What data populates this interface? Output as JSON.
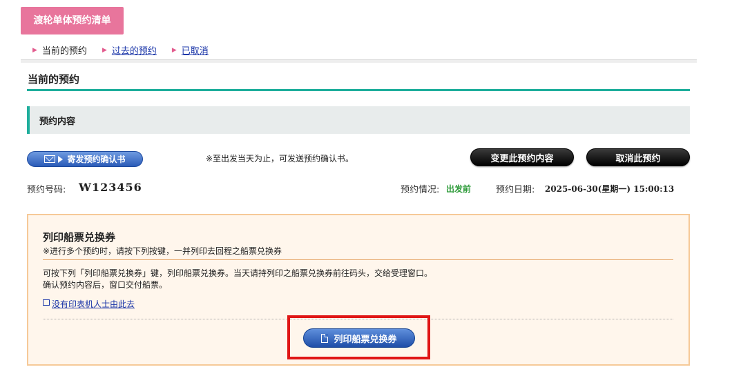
{
  "header": {
    "tab_title": "渡轮单体预约清单"
  },
  "subnav": {
    "current": "当前的预约",
    "past": "过去的预约",
    "cancelled": "已取消"
  },
  "page": {
    "title": "当前的预约"
  },
  "section": {
    "title": "预约内容"
  },
  "actions": {
    "send_confirmation": "寄发预约确认书",
    "send_note": "※至出发当天为止，可发送预约确认书。",
    "change": "变更此预约内容",
    "cancel": "取消此预约"
  },
  "reservation": {
    "number_label": "预约号码:",
    "number": "W123456",
    "status_label": "预约情况:",
    "status": "出发前",
    "date_label": "预约日期:",
    "date": "2025-06-30(星期一) 15:00:13"
  },
  "print_section": {
    "title": "列印船票兑换券",
    "subtitle": "※进行多个预约时，请按下列按键，一并列印去回程之船票兑换券",
    "desc_line1": "可按下列「列印船票兑换券」键，列印船票兑换券。当天请持列印之船票兑换券前往码头，交给受理窗口。",
    "desc_line2": "确认预约内容后，窗口交付船票。",
    "no_printer_link": "没有印表机人士由此去",
    "print_button": "列印船票兑换券"
  },
  "colors": {
    "brand_pink": "#e8759c",
    "teal": "#1fae9c",
    "status_green": "#2e9b3a",
    "highlight_red": "#e01616"
  }
}
